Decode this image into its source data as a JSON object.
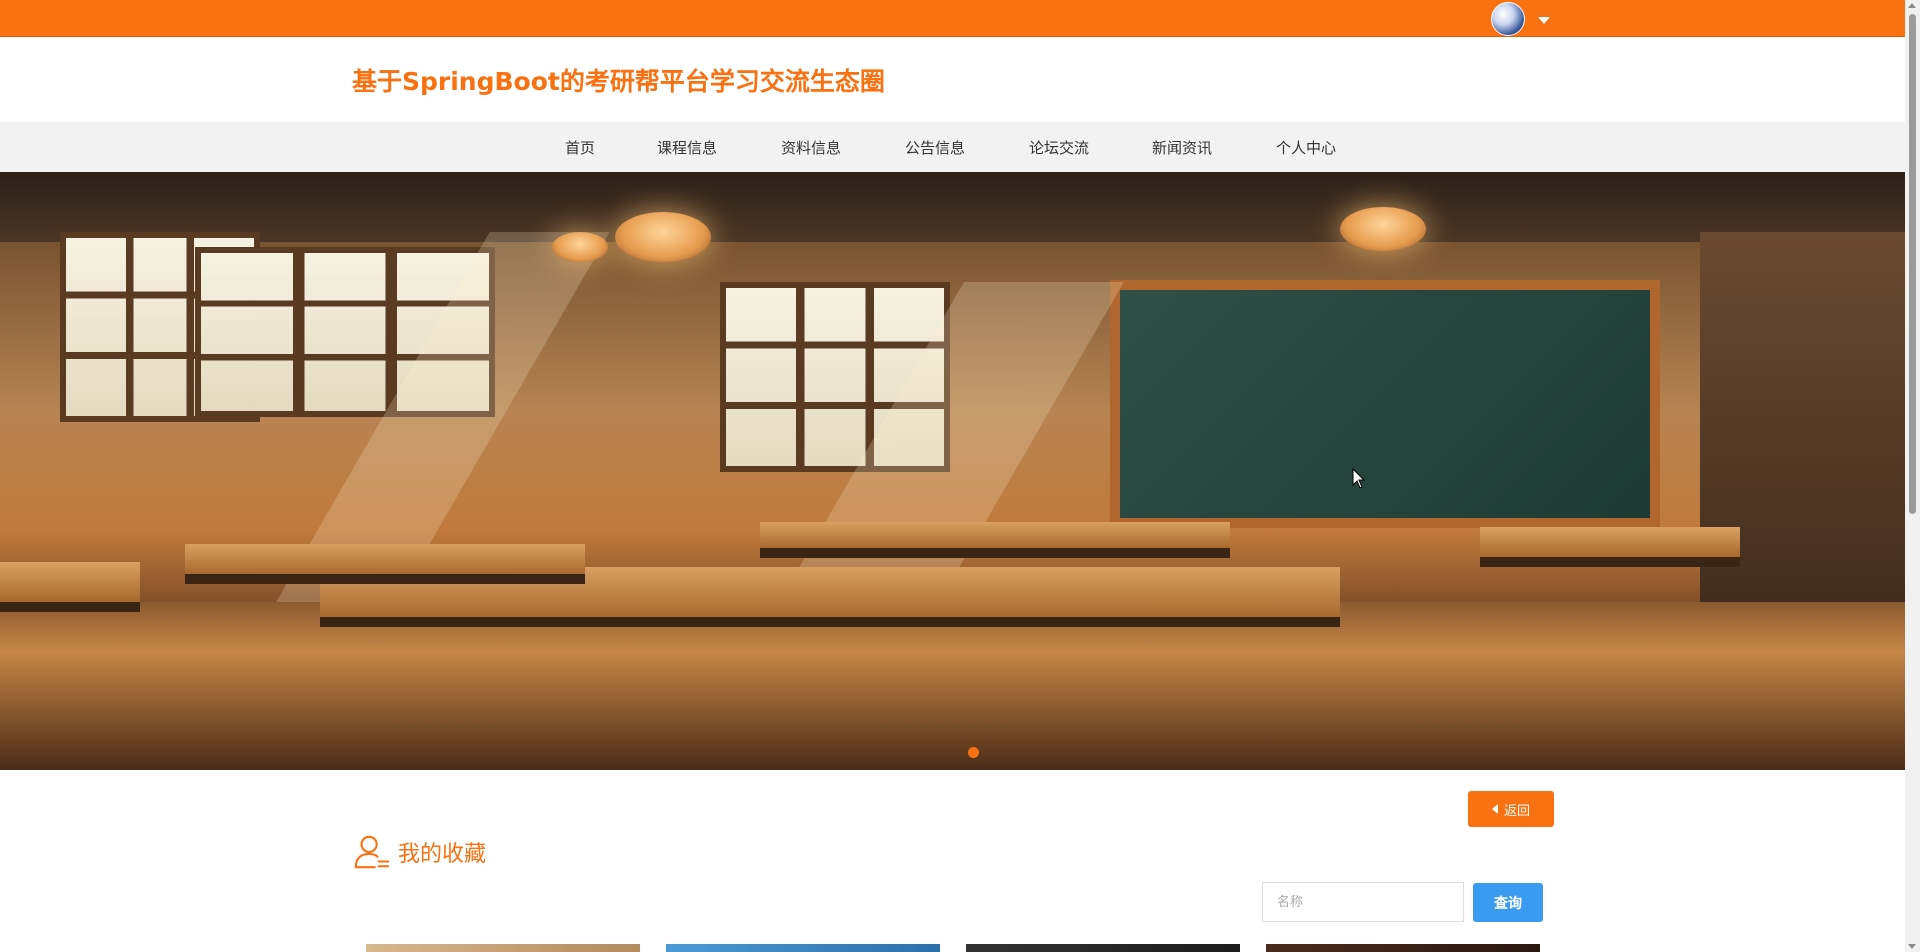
{
  "colors": {
    "accent": "#f97111",
    "search_button": "#3a9bf0",
    "nav_background": "#f2f2f2"
  },
  "topbar": {
    "avatar_icon": "avatar-icon",
    "dropdown_icon": "caret-down-icon"
  },
  "header": {
    "title": "基于SpringBoot的考研帮平台学习交流生态圈"
  },
  "nav": {
    "items": [
      {
        "label": "首页"
      },
      {
        "label": "课程信息"
      },
      {
        "label": "资料信息"
      },
      {
        "label": "公告信息"
      },
      {
        "label": "论坛交流"
      },
      {
        "label": "新闻资讯"
      },
      {
        "label": "个人中心"
      }
    ]
  },
  "banner": {
    "image_description": "classroom",
    "carousel_active_index": 0
  },
  "content": {
    "back_label": "返回",
    "section_title": "我的收藏",
    "section_icon": "user-icon",
    "search": {
      "placeholder": "名称",
      "value": "",
      "button_label": "查询"
    },
    "cards": [
      {
        "thumb_color": "#c8a57a"
      },
      {
        "thumb_color": "#3a88c8"
      },
      {
        "thumb_color": "#2a2a2a"
      },
      {
        "thumb_color": "#3a2218"
      }
    ]
  }
}
